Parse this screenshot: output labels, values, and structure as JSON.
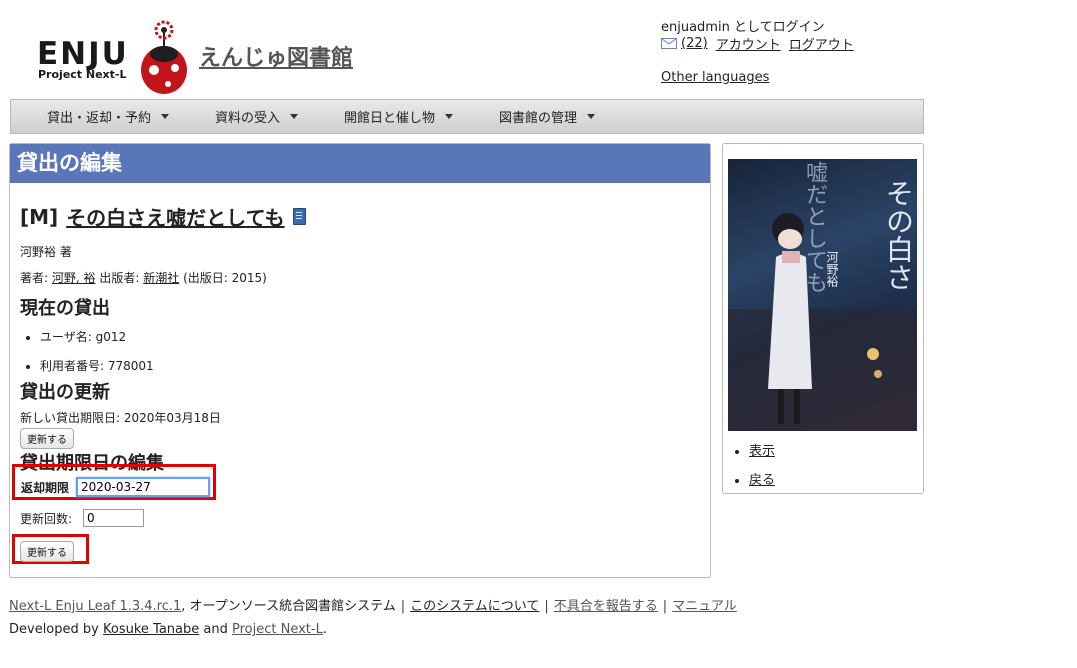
{
  "header": {
    "logo_big": "ENJU",
    "logo_small": "Project Next-L",
    "site_title": "えんじゅ図書館",
    "login_text": "enjuadmin としてログイン",
    "message_count": "(22)",
    "account_link": "アカウント",
    "logout_link": "ログアウト",
    "other_languages": "Other languages"
  },
  "nav": {
    "items": [
      {
        "label": "貸出・返却・予約"
      },
      {
        "label": "資料の受入"
      },
      {
        "label": "開館日と催し物"
      },
      {
        "label": "図書館の管理"
      }
    ]
  },
  "main": {
    "panel_title": "貸出の編集",
    "book_prefix": "[M]",
    "book_title": "その白さえ嘘だとしても",
    "author_line": "河野裕 著",
    "creator_label": "著者:",
    "creator_name": "河野, 裕",
    "publisher_label": "出版者:",
    "publisher_name": "新潮社",
    "pub_date_text": "(出版日: 2015)",
    "current_heading": "現在の貸出",
    "current_items": [
      {
        "text": "ユーザ名: g012"
      },
      {
        "text": "利用者番号: 778001"
      }
    ],
    "renew_heading": "貸出の更新",
    "new_due_text": "新しい貸出期限日: 2020年03月18日",
    "renew_button": "更新する",
    "edit_due_heading": "貸出期限日の編集",
    "due_label": "返却期限",
    "due_value": "2020-03-27",
    "renew_count_label": "更新回数:",
    "renew_count_value": "0",
    "update_button": "更新する"
  },
  "side": {
    "cover_text_1": "その白さ",
    "cover_text_2": "嘘だとしても",
    "cover_author": "河野裕",
    "links": [
      {
        "label": "表示"
      },
      {
        "label": "戻る"
      }
    ]
  },
  "footer": {
    "product": "Next-L Enju Leaf 1.3.4.rc.1",
    "product_desc": ", オープンソース統合図書館システム",
    "about": "このシステムについて",
    "report_bug": "不具合を報告する",
    "manual": "マニュアル",
    "developed_by": "Developed by",
    "developer": "Kosuke Tanabe",
    "and": "and",
    "project": "Project Next-L",
    "period": "."
  },
  "colors": {
    "panel_header": "#5876b8",
    "highlight_red": "#e00000"
  }
}
